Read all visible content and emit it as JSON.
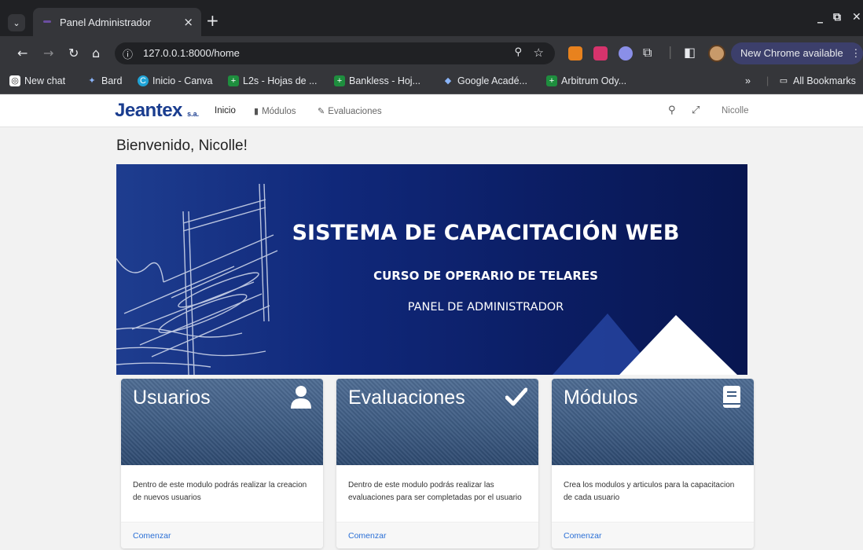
{
  "browser": {
    "tab_title": "Panel Administrador",
    "tab_close": "×",
    "new_tab": "+",
    "url": "127.0.0.1:8000/home",
    "update_button": "New Chrome available",
    "bookmarks": [
      {
        "label": "New chat",
        "icon": "chatgpt-icon"
      },
      {
        "label": "Bard",
        "icon": "bard-sparkle-icon"
      },
      {
        "label": "Inicio - Canva",
        "icon": "canva-icon"
      },
      {
        "label": "L2s - Hojas de ...",
        "icon": "sheets-icon"
      },
      {
        "label": "Bankless - Hoj...",
        "icon": "sheets-icon"
      },
      {
        "label": "Google Acadé...",
        "icon": "scholar-icon"
      },
      {
        "label": "Arbitrum Ody...",
        "icon": "sheets-icon"
      }
    ],
    "bookmarks_overflow": "»",
    "all_bookmarks": "All Bookmarks"
  },
  "app": {
    "logo": "Jeantex",
    "logo_suffix": "s.a.",
    "nav": {
      "inicio": "Inicio",
      "modulos": "Módulos",
      "evaluaciones": "Evaluaciones"
    },
    "user": "Nicolle",
    "welcome": "Bienvenido, Nicolle!"
  },
  "banner": {
    "title": "SISTEMA DE CAPACITACIÓN WEB",
    "subtitle": "CURSO DE OPERARIO DE TELARES",
    "panel": "PANEL DE ADMINISTRADOR"
  },
  "cards": [
    {
      "title": "Usuarios",
      "icon": "user-icon",
      "text": "Dentro de este modulo podrás realizar la creacion de nuevos usuarios",
      "link": "Comenzar"
    },
    {
      "title": "Evaluaciones",
      "icon": "check-icon",
      "text": "Dentro de este modulo podrás realizar las evaluaciones para ser completadas por el usuario",
      "link": "Comenzar"
    },
    {
      "title": "Módulos",
      "icon": "book-icon",
      "text": "Crea los modulos y articulos para la capacitacion de cada usuario",
      "link": "Comenzar"
    }
  ],
  "colors": {
    "brand": "#1a3d8f",
    "banner_dark": "#081650",
    "link": "#2a6fd6"
  }
}
